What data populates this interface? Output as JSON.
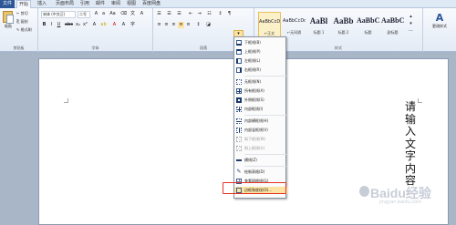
{
  "tabs": [
    "文件",
    "开始",
    "插入",
    "页面布局",
    "引用",
    "邮件",
    "审阅",
    "视图",
    "百度网盘"
  ],
  "clipboard": {
    "paste_label": "粘贴",
    "cut": "剪切",
    "copy": "复制",
    "format_painter": "格式刷",
    "group_label": "剪贴板"
  },
  "font": {
    "font_name": "宋体 (中文正)",
    "font_size": "二号",
    "group_label": "字体"
  },
  "paragraph": {
    "group_label": "段落"
  },
  "styles": {
    "items": [
      {
        "sample": "AaBbCcDd",
        "name": "↵正文"
      },
      {
        "sample": "AaBbCcDd",
        "name": "↵无间隔"
      },
      {
        "sample": "AaBl",
        "name": "标题 1"
      },
      {
        "sample": "AaBb",
        "name": "标题 2"
      },
      {
        "sample": "AaBbC",
        "name": "标题"
      },
      {
        "sample": "AaBbC",
        "name": "副标题"
      }
    ],
    "change_styles": "更改样式",
    "group_label": "样式"
  },
  "borders_menu": {
    "items": [
      {
        "label": "下框线(B)",
        "icon": "bottom-border-icon"
      },
      {
        "label": "上框线(P)",
        "icon": "top-border-icon"
      },
      {
        "label": "左框线(L)",
        "icon": "left-border-icon"
      },
      {
        "label": "右框线(R)",
        "icon": "right-border-icon"
      },
      {
        "label": "无框线(N)",
        "icon": "no-border-icon"
      },
      {
        "label": "所有框线(A)",
        "icon": "all-borders-icon"
      },
      {
        "label": "外侧框线(S)",
        "icon": "outside-borders-icon"
      },
      {
        "label": "内部框线(I)",
        "icon": "inside-borders-icon"
      },
      {
        "label": "内部横框线(H)",
        "icon": "inside-horizontal-border-icon"
      },
      {
        "label": "内部竖框线(V)",
        "icon": "inside-vertical-border-icon"
      },
      {
        "label": "斜下框线(W)",
        "icon": "diagonal-down-border-icon"
      },
      {
        "label": "斜上框线(U)",
        "icon": "diagonal-up-border-icon"
      },
      {
        "label": "横线(Z)",
        "icon": "horizontal-line-icon"
      },
      {
        "label": "绘制表格(D)",
        "icon": "draw-table-icon"
      },
      {
        "label": "查看网格线(G)",
        "icon": "view-gridlines-icon"
      },
      {
        "label": "边框和底纹(O)...",
        "icon": "borders-shading-icon"
      }
    ]
  },
  "document": {
    "vertical_text": "请输入文字内容"
  },
  "watermark": {
    "text": "Baidu经验",
    "url": "jingyan.baidu.com"
  },
  "colors": {
    "accent": "#2b5797",
    "highlight": "#fde3a3",
    "callout": "#e53323"
  }
}
